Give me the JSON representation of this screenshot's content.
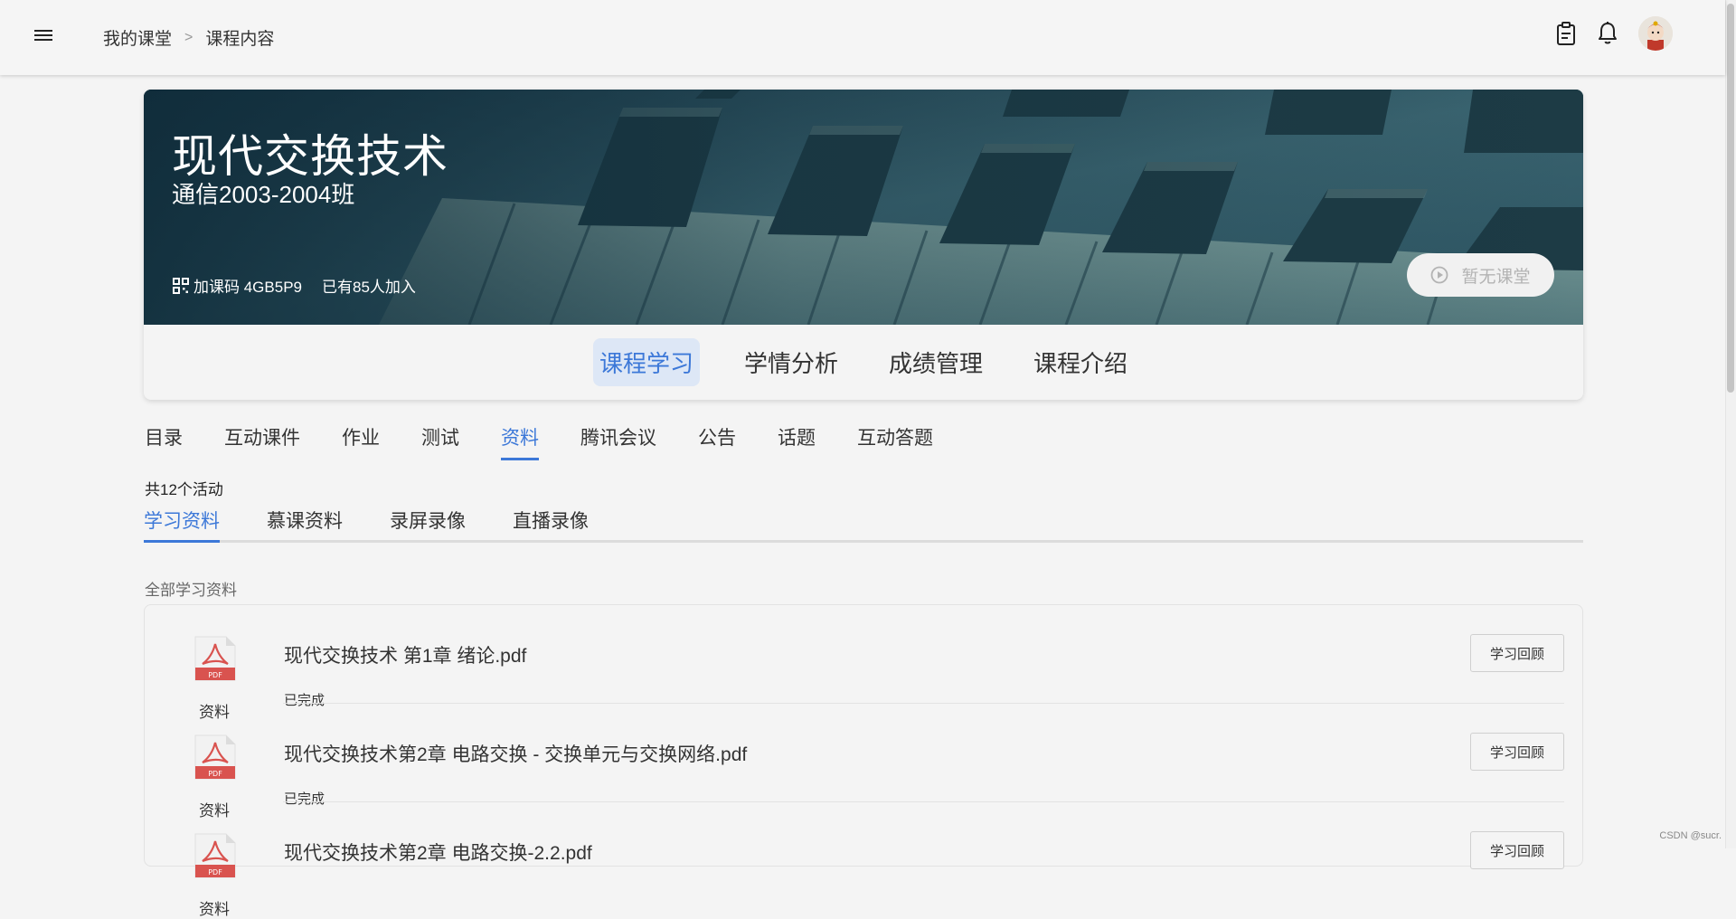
{
  "breadcrumb": {
    "items": [
      "我的课堂",
      "课程内容"
    ],
    "separator": ">"
  },
  "header_icons": [
    "clipboard-icon",
    "bell-icon",
    "avatar"
  ],
  "course": {
    "title": "现代交换技术",
    "class_name": "通信2003-2004班",
    "join_code_label": "加课码 4GB5P9",
    "joined_label": "已有85人加入",
    "live_button": "暂无课堂"
  },
  "main_tabs": [
    {
      "label": "课程学习",
      "active": true
    },
    {
      "label": "学情分析",
      "active": false
    },
    {
      "label": "成绩管理",
      "active": false
    },
    {
      "label": "课程介绍",
      "active": false
    }
  ],
  "sub_nav": [
    {
      "label": "目录",
      "active": false
    },
    {
      "label": "互动课件",
      "active": false
    },
    {
      "label": "作业",
      "active": false
    },
    {
      "label": "测试",
      "active": false
    },
    {
      "label": "资料",
      "active": true
    },
    {
      "label": "腾讯会议",
      "active": false
    },
    {
      "label": "公告",
      "active": false
    },
    {
      "label": "话题",
      "active": false
    },
    {
      "label": "互动答题",
      "active": false
    }
  ],
  "activity_count": "共12个活动",
  "resource_tabs": [
    {
      "label": "学习资料",
      "active": true
    },
    {
      "label": "慕课资料",
      "active": false
    },
    {
      "label": "录屏录像",
      "active": false
    },
    {
      "label": "直播录像",
      "active": false
    }
  ],
  "section_label": "全部学习资料",
  "materials": [
    {
      "kind": "资料",
      "name": "现代交换技术 第1章 绪论.pdf",
      "status": "已完成",
      "action": "学习回顾"
    },
    {
      "kind": "资料",
      "name": "现代交换技术第2章 电路交换 - 交换单元与交换网络.pdf",
      "status": "已完成",
      "action": "学习回顾"
    },
    {
      "kind": "资料",
      "name": "现代交换技术第2章 电路交换-2.2.pdf",
      "status": "",
      "action": "学习回顾"
    }
  ],
  "watermark": "CSDN @sucr.",
  "colors": {
    "accent": "#3c78d8",
    "active_tab_bg": "#dde7f6",
    "banner_base": "#274c5a",
    "pdf_red": "#d9534f"
  }
}
